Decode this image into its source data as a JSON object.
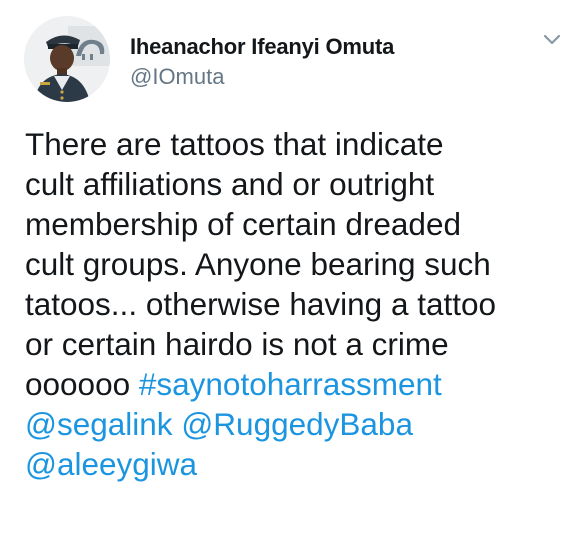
{
  "tweet": {
    "author": {
      "display_name": "Iheanachor Ifeanyi Omuta",
      "handle": "@IOmuta",
      "avatar_icon": "user-avatar"
    },
    "menu_icon": "chevron-down-icon",
    "text_lines": [
      "There are tattoos that indicate",
      "cult affiliations and or outright",
      "membership of certain dreaded",
      "cult groups. Anyone bearing such",
      "tatoos... otherwise having a tattoo",
      "or certain hairdo is not a crime"
    ],
    "line7_prefix": "oooooo ",
    "hashtag": "#saynotoharrassment",
    "mention_1": "@segalink",
    "mention_2": "@RuggedyBaba",
    "mention_3": "@aleeygiwa"
  },
  "colors": {
    "text": "#14171a",
    "secondary": "#657786",
    "link": "#1b95e0"
  }
}
